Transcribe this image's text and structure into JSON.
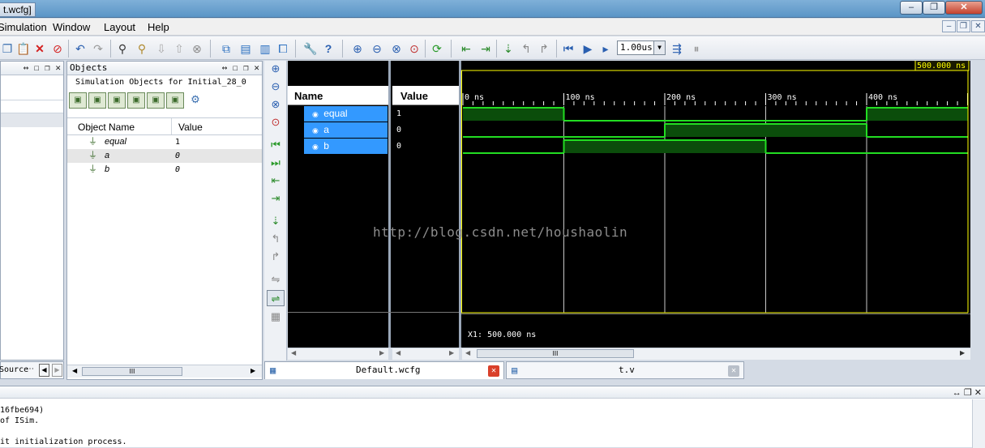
{
  "window": {
    "title": "t.wcfg]",
    "buttons": {
      "minimize": "–",
      "restore": "❐",
      "close": "✕"
    }
  },
  "menu": {
    "items": [
      "Simulation",
      "Window",
      "Layout",
      "Help"
    ],
    "mdi_buttons": [
      "–",
      "❐",
      "✕"
    ]
  },
  "toolbar": {
    "time_value": "1.00us",
    "combo_arrow": "▼"
  },
  "left_panel": {
    "pin_controls": "↔ ☐ ❐ ✕",
    "tab_label": "Source",
    "tab_more": "⋯"
  },
  "objects_panel": {
    "title": "Objects",
    "title_controls": "↔ ☐ ❐ ✕",
    "subtitle": "Simulation Objects for Initial_28_0",
    "columns": {
      "name": "Object Name",
      "value": "Value"
    },
    "rows": [
      {
        "name": "equal",
        "value": "1"
      },
      {
        "name": "a",
        "value": "0"
      },
      {
        "name": "b",
        "value": "0"
      }
    ],
    "scroll_grip": "III",
    "scroll_left": "◀",
    "scroll_right": "▶"
  },
  "wave_window": {
    "name_header": "Name",
    "value_header": "Value",
    "signals": [
      {
        "name": "equal",
        "value": "1"
      },
      {
        "name": "a",
        "value": "0"
      },
      {
        "name": "b",
        "value": "0"
      }
    ],
    "cursor_time": "500.000 ns",
    "cursor_readout": "X1: 500.000 ns",
    "time_ticks": [
      "0 ns",
      "100 ns",
      "200 ns",
      "300 ns",
      "400 ns"
    ],
    "scroll_grip": "III",
    "scroll_left": "◀",
    "scroll_right": "▶",
    "watermark": "http://blog.csdn.net/houshaolin",
    "colors": {
      "wave": "#22dd22",
      "fill": "#0b4d0b",
      "grid": "#c8c8c8",
      "cursor": "#ffff00"
    },
    "waveforms": {
      "equal": [
        {
          "from": 0,
          "to": 100,
          "level": 1
        },
        {
          "from": 100,
          "to": 300,
          "level": 0
        },
        {
          "from": 300,
          "to": 400,
          "level": 0
        },
        {
          "from": 400,
          "to": 500,
          "level": 1
        }
      ],
      "a": [
        {
          "from": 0,
          "to": 100,
          "level": 0
        },
        {
          "from": 100,
          "to": 200,
          "level": 0
        },
        {
          "from": 200,
          "to": 300,
          "level": 1
        },
        {
          "from": 300,
          "to": 400,
          "level": 1
        },
        {
          "from": 400,
          "to": 500,
          "level": 0
        }
      ],
      "b": [
        {
          "from": 0,
          "to": 100,
          "level": 0
        },
        {
          "from": 100,
          "to": 300,
          "level": 1
        },
        {
          "from": 300,
          "to": 500,
          "level": 0
        }
      ]
    }
  },
  "tabs": [
    {
      "label": "Default.wcfg",
      "close": "✕"
    },
    {
      "label": "t.v",
      "close": "✕"
    }
  ],
  "console": {
    "controls": "↔ ❐ ✕",
    "lines": [
      "16fbe694)",
      "of ISim.",
      "",
      "it initialization process."
    ]
  }
}
